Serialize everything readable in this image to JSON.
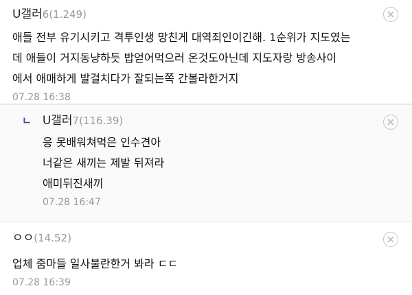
{
  "comments": [
    {
      "author": "U갤러",
      "level": "6",
      "score": "(1.249)",
      "lines": [
        "애들 전부 유기시키고 격투인생 망친게 대역죄인이긴해. 1순위가 지도였는",
        "데 애들이 거지동냥하듯 밥얻어먹으러 온것도아닌데 지도자랑 방송사이",
        "에서 애매하게 발걸치다가 잘되는쪽 간볼라한거지"
      ],
      "time": "07.28 16:38",
      "is_reply": false
    },
    {
      "reply_marker": "ㄴ",
      "author": "U갤러",
      "level": "7",
      "score": "(116.39)",
      "lines": [
        "응 못배워쳐먹은 인수견아",
        "너같은 새끼는 제발 뒤져라",
        "애미뒤진새끼"
      ],
      "time": "07.28 16:47",
      "is_reply": true
    },
    {
      "author": "ㅇㅇ",
      "level": "",
      "score": "(14.52)",
      "lines": [
        "업체 줌마들 일사불란한거 봐라 ㄷㄷ"
      ],
      "time": "07.28 16:39",
      "is_reply": false
    }
  ],
  "icons": {
    "delete": "close-circle-icon",
    "reply": "reply-arrow-icon"
  },
  "colors": {
    "meta_gray": "#999999",
    "reply_accent": "#3a4a9a",
    "divider": "#e2e2e2"
  }
}
